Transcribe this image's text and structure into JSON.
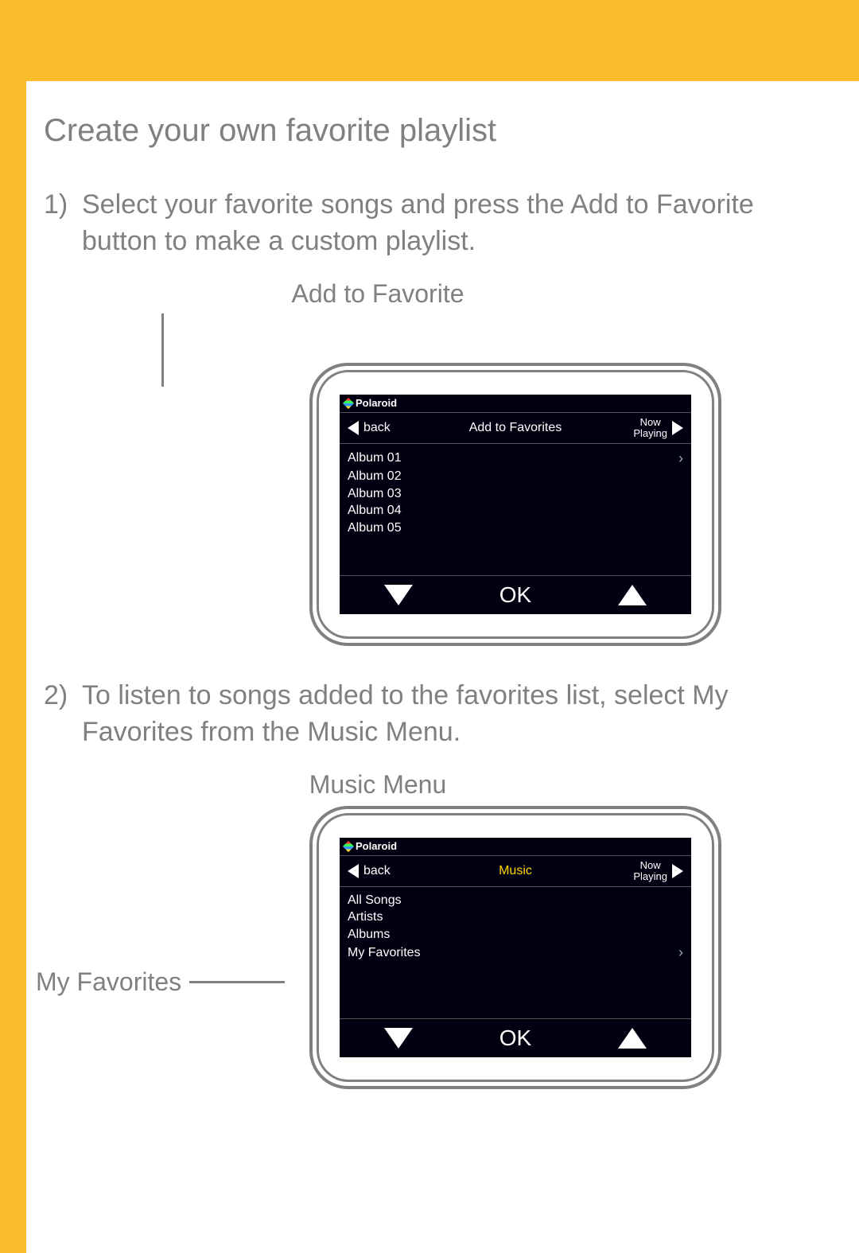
{
  "title": "Create your own favorite playlist",
  "steps": {
    "s1": {
      "num": "1)",
      "text": "Select your favorite songs and press the  Add to Favorite  button to make a custom playlist."
    },
    "s2": {
      "num": "2)",
      "text": "To listen to songs added to the favorites list, select My Favorites  from the Music Menu."
    }
  },
  "callouts": {
    "addToFavorite": "Add to Favorite",
    "musicMenu": "Music Menu",
    "myFavorites": "My Favorites"
  },
  "device": {
    "brand": "Polaroid",
    "backLabel": "back",
    "nowPlaying": "Now\nPlaying",
    "okLabel": "OK"
  },
  "screen1": {
    "headerCenter": "Add to Favorites",
    "items": [
      "Album 01",
      "Album 02",
      "Album 03",
      "Album 04",
      "Album 05"
    ]
  },
  "screen2": {
    "headerCenter": "Music",
    "items": [
      "All Songs",
      "Artists",
      "Albums",
      "My Favorites"
    ]
  }
}
